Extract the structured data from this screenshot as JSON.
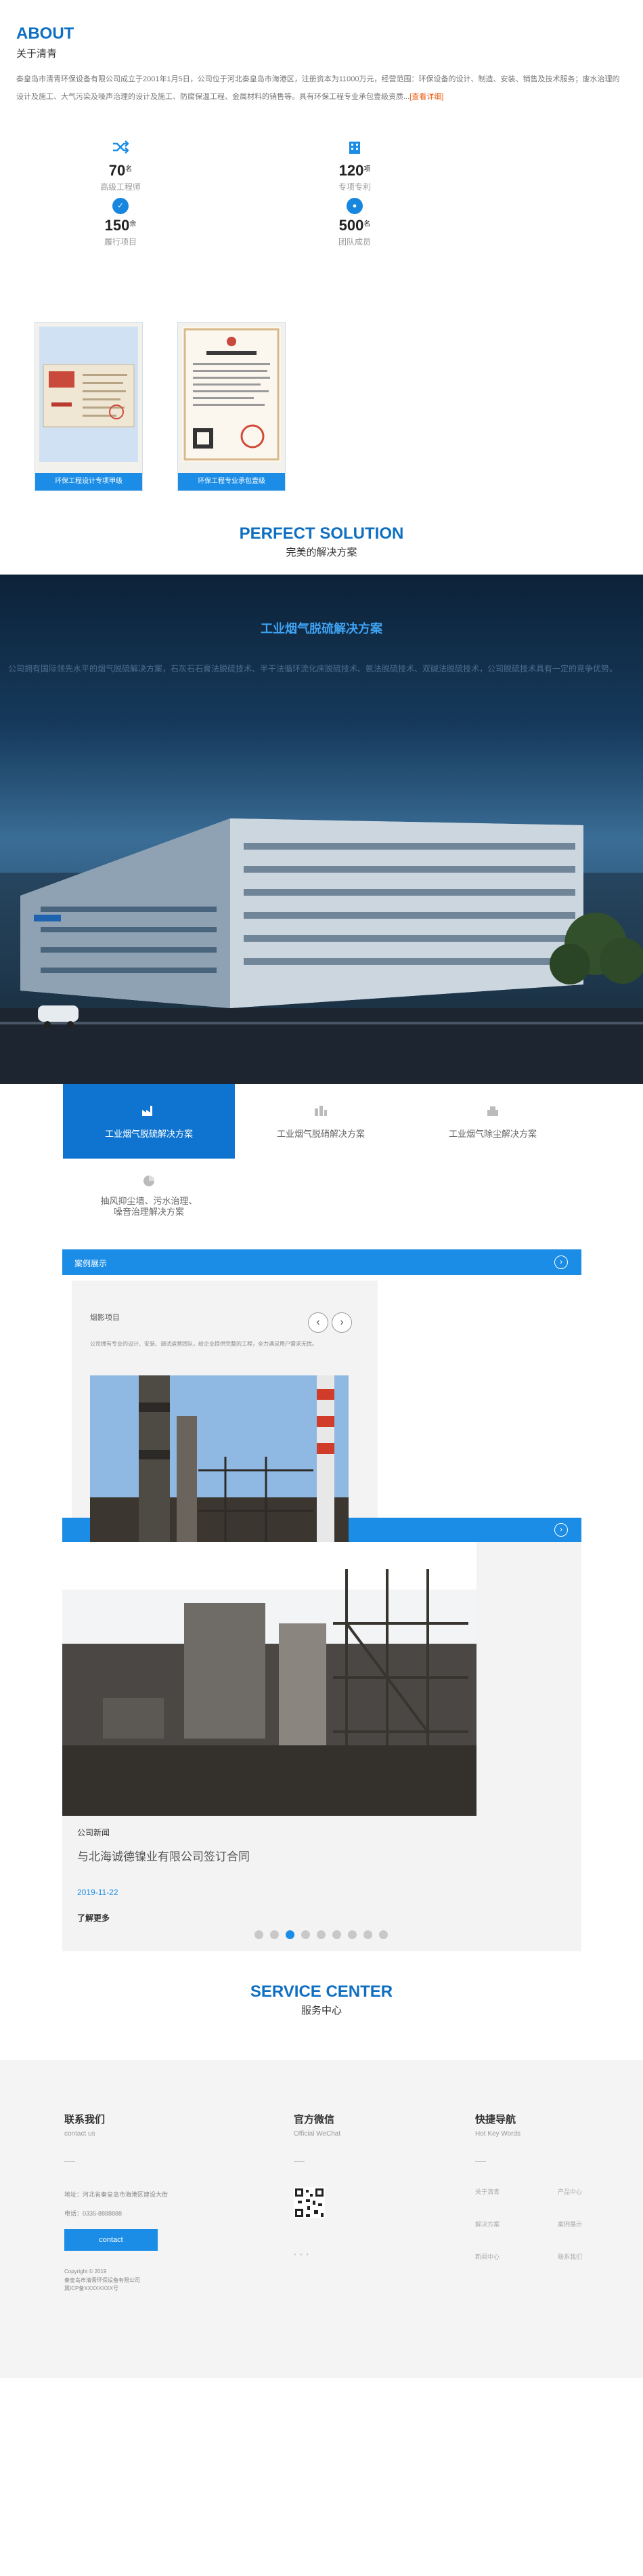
{
  "about": {
    "title": "ABOUT",
    "subtitle": "关于清青",
    "text": "秦皇岛市清青环保设备有限公司成立于2001年1月5日，公司位于河北秦皇岛市海港区，注册资本为11000万元，经营范围：环保设备的设计、制造、安装、销售及技术服务；废水治理的设计及施工、大气污染及噪声治理的设计及施工、防腐保温工程、金属材料的销售等。具有环保工程专业承包壹级资质...",
    "more": "[查看详细]",
    "stats": [
      {
        "num": "70",
        "unit": "名",
        "label": "高级工程师",
        "icon": "shuffle-icon"
      },
      {
        "num": "120",
        "unit": "项",
        "label": "专项专利",
        "icon": "building-icon"
      },
      {
        "num": "150",
        "unit": "余",
        "label": "履行项目",
        "icon": "badge-icon"
      },
      {
        "num": "500",
        "unit": "名",
        "label": "团队成员",
        "icon": "chat-icon"
      }
    ],
    "certs": [
      {
        "caption": "环保工程设计专项甲级"
      },
      {
        "caption": "环保工程专业承包壹级"
      }
    ]
  },
  "solution": {
    "title": "PERFECT SOLUTION",
    "subtitle": "完美的解决方案",
    "hero_title": "工业烟气脱硫解决方案",
    "hero_desc": "公司拥有国际领先水平的烟气脱硫解决方案，石灰石石膏法脱硫技术、半干法循环流化床脱硫技术、氨法脱硫技术、双碱法脱硫技术，公司脱硫技术具有一定的竞争优势。",
    "tabs": [
      {
        "label": "工业烟气脱硫解决方案",
        "icon": "factory-icon"
      },
      {
        "label": "工业烟气脱硝解决方案",
        "icon": "plant-icon"
      },
      {
        "label": "工业烟气除尘解决方案",
        "icon": "dust-icon"
      },
      {
        "label": "抽风抑尘墙、污水治理、噪音治理解决方案",
        "icon": "pie-icon"
      }
    ]
  },
  "cases": {
    "bar_label": "案例展示",
    "card_title": "烟影项目",
    "card_desc": "公司拥有专业的设计、安装、调试运营团队，给企业提供完整的工程，全力满足用户需求无忧。",
    "news_category": "公司新闻",
    "news_title": "与北海诚德镍业有限公司签订合同",
    "news_date": "2019-11-22",
    "news_more": "了解更多"
  },
  "service": {
    "title": "SERVICE CENTER",
    "subtitle": "服务中心"
  },
  "footer": {
    "contact_title": "联系我们",
    "contact_sub": "contact us",
    "address": "地址：河北省秦皇岛市海港区建设大街",
    "phone": "电话：0335-8888888",
    "contact_btn": "contact",
    "copyright": "Copyright © 2019",
    "company": "秦皇岛市清青环保设备有限公司",
    "icp": "冀ICP备XXXXXXXX号",
    "wechat_title": "官方微信",
    "wechat_sub": "Official WeChat",
    "nav_title": "快捷导航",
    "nav_sub": "Hot Key Words",
    "nav_links": [
      "关于清青",
      "产品中心",
      "解决方案",
      "案例展示",
      "新闻中心",
      "联系我们"
    ]
  },
  "colors": {
    "brand": "#0e6fc2",
    "accent": "#1b8de6",
    "more": "#e8590c"
  }
}
